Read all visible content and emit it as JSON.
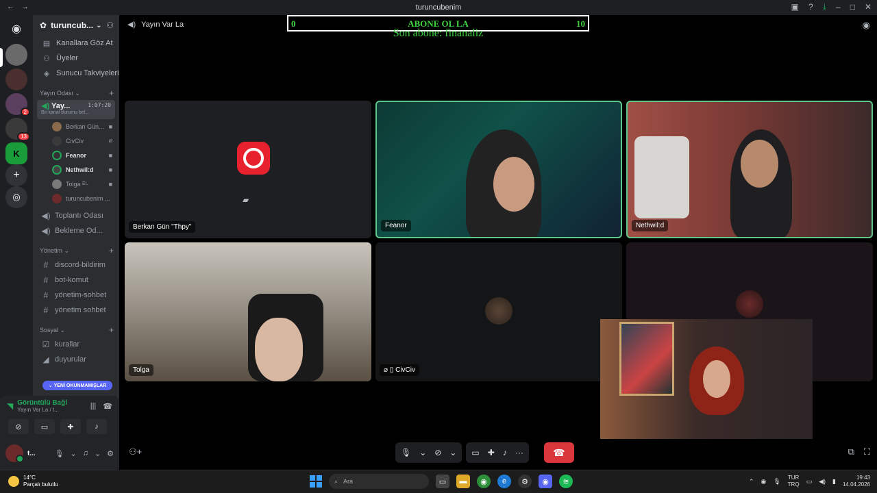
{
  "window": {
    "title": "turuncubenim"
  },
  "server": {
    "name": "turuncub...",
    "nav": [
      "Kanallara Göz At",
      "Üyeler",
      "Sunucu Takviyeleri"
    ]
  },
  "categories": {
    "yayin": {
      "label": "Yayın Odası"
    },
    "yonetim": {
      "label": "Yönetim"
    },
    "sosyal": {
      "label": "Sosyal"
    }
  },
  "voice_channel": {
    "name": "Yay...",
    "time": "1:07:20",
    "status": "Bir kanal durumu bel..."
  },
  "members": [
    "Berkan Gün...",
    "CivCiv",
    "Feanor",
    "Nethwil:d",
    "Tolga",
    "turuncubenim ..."
  ],
  "member_tag": "EL",
  "other_voice": [
    "Toplantı Odası",
    "Bekleme Od..."
  ],
  "yonetim_channels": [
    "discord-bildirim",
    "bot-komut",
    "yönetim-sohbet",
    "yönetim sohbet"
  ],
  "sosyal_channels": [
    "kurallar",
    "duyurular"
  ],
  "unread_pill": "YENİ OKUNMAMIŞLAR",
  "voice_panel": {
    "status": "Görüntülü Bağl",
    "channel": "Yayın Var La / t..."
  },
  "user": {
    "name": "t..."
  },
  "call": {
    "title": "Yayın Var La"
  },
  "overlay": {
    "left": "0",
    "center": "ABONE OL LA",
    "right": "10",
    "ticker": "Son abone: finanaliz"
  },
  "tiles": {
    "t1": "Berkan Gün \"Thpy\"",
    "t2": "Feanor",
    "t3": "Nethwil:d",
    "t4": "Tolga",
    "t5": "CivCiv"
  },
  "taskbar": {
    "temp": "14°C",
    "weather": "Parçalı bulutlu",
    "search_placeholder": "Ara",
    "lang1": "TUR",
    "lang2": "TRQ",
    "time": "19:43",
    "date": "14.04.2026"
  },
  "rail_badges": [
    "2",
    "13"
  ],
  "colors": {
    "accent": "#5865f2",
    "green": "#23a55a",
    "danger": "#da373c",
    "overlay_text": "#3fd43f"
  }
}
